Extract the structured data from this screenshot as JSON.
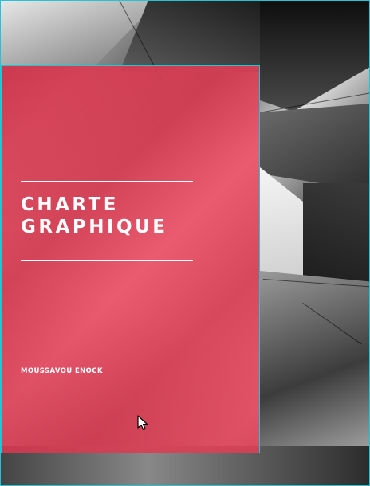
{
  "cover": {
    "title_line1": "CHARTE",
    "title_line2": "GRAPHIQUE",
    "author": "MOUSSAVOU ENOCK"
  },
  "colors": {
    "panel": "#EC465E",
    "selection_outline": "#22C4D6",
    "text": "#FFFFFF"
  },
  "icons": {
    "cursor": "mouse-pointer-icon"
  }
}
